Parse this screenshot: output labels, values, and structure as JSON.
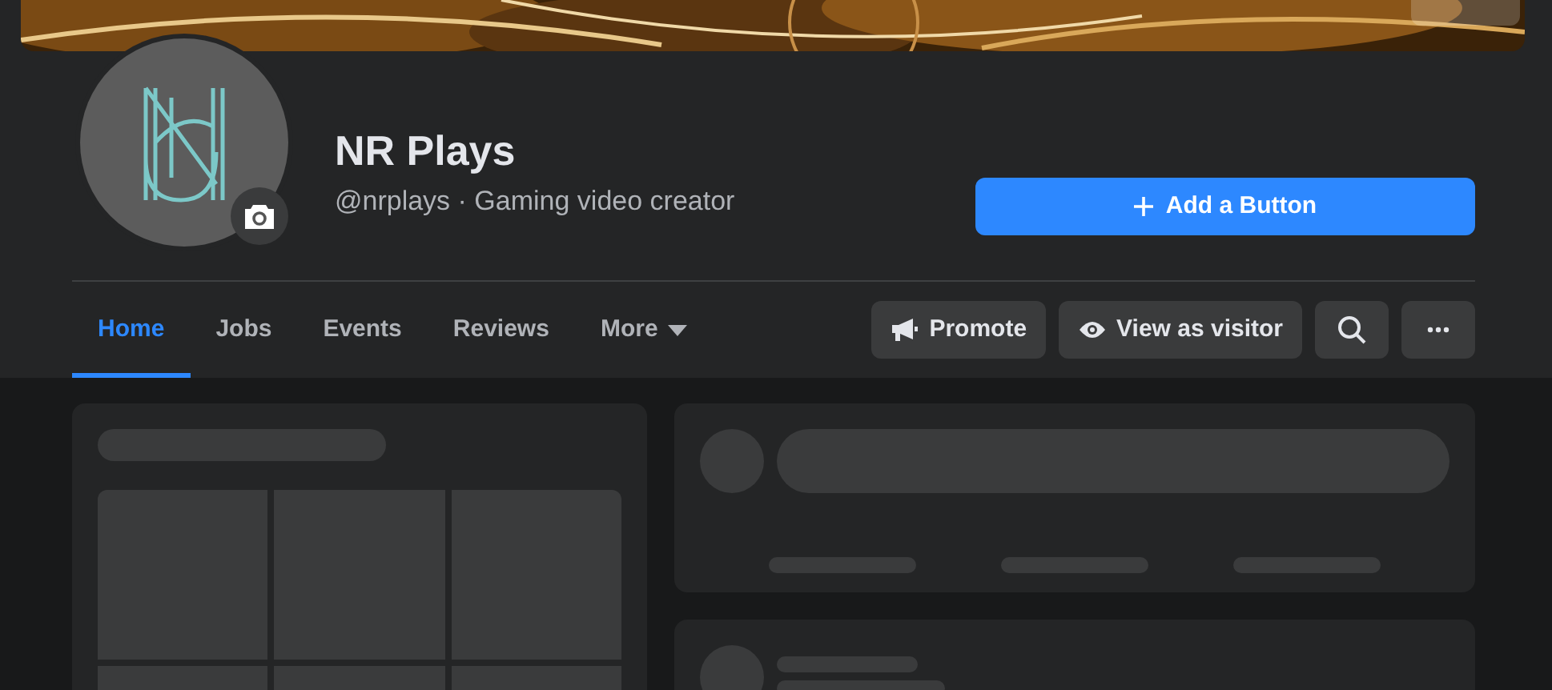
{
  "profile": {
    "name": "NR Plays",
    "subtitle": "@nrplays · Gaming video creator"
  },
  "add_button": {
    "label": "Add a Button"
  },
  "tabs": [
    {
      "label": "Home",
      "selected": true
    },
    {
      "label": "Jobs",
      "selected": false
    },
    {
      "label": "Events",
      "selected": false
    },
    {
      "label": "Reviews",
      "selected": false
    },
    {
      "label": "More",
      "selected": false,
      "dropdown": true
    }
  ],
  "actions": [
    {
      "kind": "promote",
      "label": "Promote"
    },
    {
      "kind": "visitor",
      "label": "View as visitor"
    },
    {
      "kind": "search"
    },
    {
      "kind": "more"
    }
  ]
}
